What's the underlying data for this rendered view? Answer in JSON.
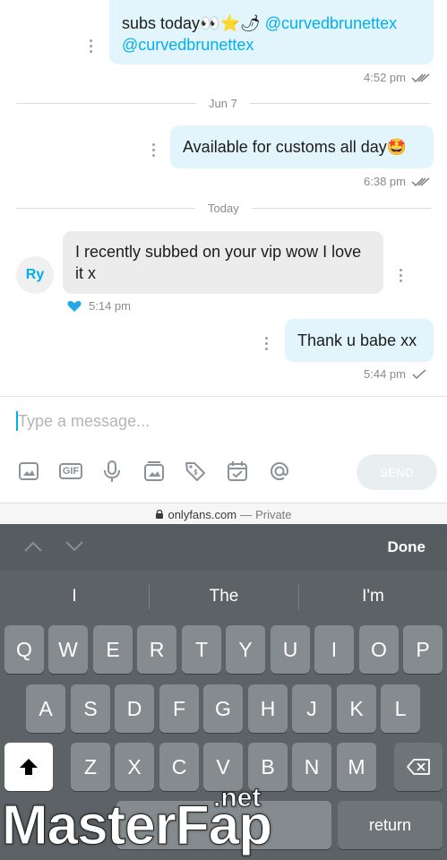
{
  "chat": {
    "msg1": {
      "text_pre": "subs today👀⭐🌶",
      "mention1": "@curvedbrunettex",
      "mention2": "@curvedbrunettex",
      "time": "4:52 pm"
    },
    "divider1": "Jun 7",
    "msg2": {
      "text": "Available for customs all day🤩",
      "time": "6:38 pm"
    },
    "divider2": "Today",
    "msg3": {
      "avatar": "Ry",
      "text": "I recently subbed on your vip wow I love it x",
      "time": "5:14 pm"
    },
    "msg4": {
      "text": "Thank u babe xx",
      "time": "5:44 pm"
    }
  },
  "composer": {
    "placeholder": "Type a message...",
    "send_label": "SEND",
    "tools": [
      "image-icon",
      "gif-icon",
      "microphone-icon",
      "media-vault-icon",
      "price-tag-icon",
      "calendar-icon",
      "at-mention-icon"
    ],
    "gif_text": "GIF"
  },
  "browser": {
    "domain": "onlyfans.com",
    "separator": "—",
    "mode": "Private"
  },
  "keyboard": {
    "done_label": "Done",
    "suggestions": [
      "I",
      "The",
      "I'm"
    ],
    "row1": [
      "Q",
      "W",
      "E",
      "R",
      "T",
      "Y",
      "U",
      "I",
      "O",
      "P"
    ],
    "row2": [
      "A",
      "S",
      "D",
      "F",
      "G",
      "H",
      "J",
      "K",
      "L"
    ],
    "row3": [
      "Z",
      "X",
      "C",
      "V",
      "B",
      "N",
      "M"
    ],
    "return_label": "return"
  },
  "watermark": {
    "main": "MasterFap",
    "sub": ".net"
  },
  "colors": {
    "accent": "#00aff0",
    "outgoing_bubble": "#e3f5fc",
    "incoming_bubble": "#ececec",
    "keyboard_bg": "#5c6266"
  }
}
